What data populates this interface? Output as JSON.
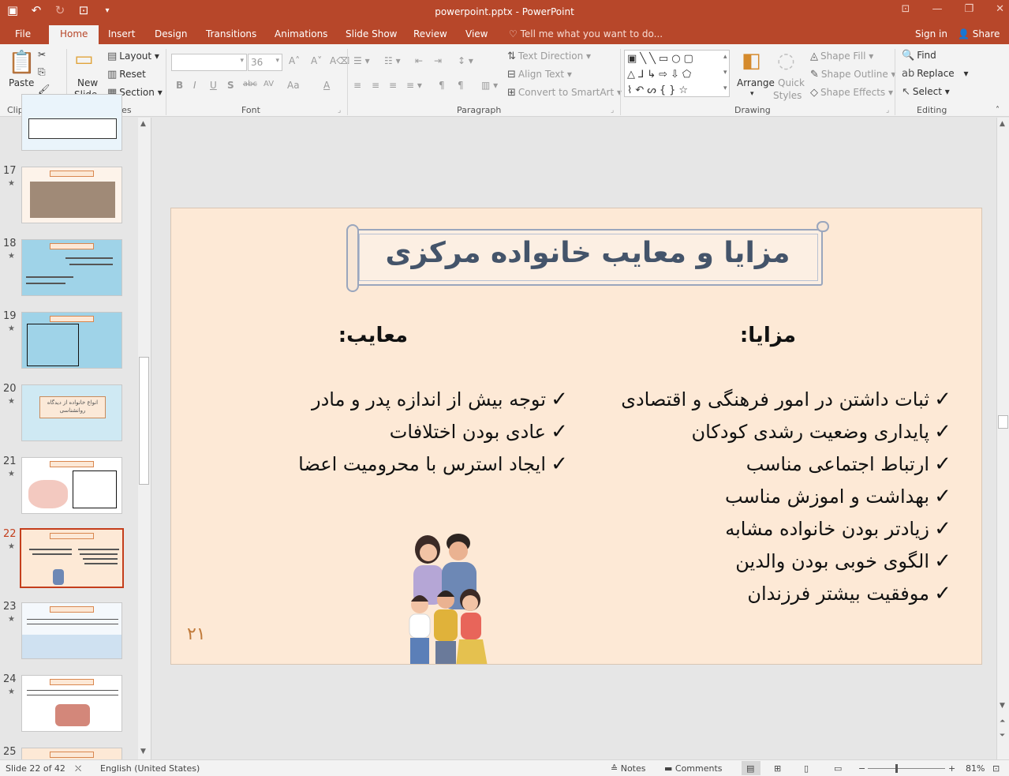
{
  "app": {
    "title": "powerpoint.pptx - PowerPoint"
  },
  "qat": {
    "save_icon": "save-icon",
    "undo_icon": "undo-icon",
    "redo_icon": "redo-icon",
    "present_icon": "present-from-start-icon",
    "customize_icon": "customize-qat-icon"
  },
  "tabs": [
    {
      "label": "File"
    },
    {
      "label": "Home"
    },
    {
      "label": "Insert"
    },
    {
      "label": "Design"
    },
    {
      "label": "Transitions"
    },
    {
      "label": "Animations"
    },
    {
      "label": "Slide Show"
    },
    {
      "label": "Review"
    },
    {
      "label": "View"
    }
  ],
  "tell_me": "Tell me what you want to do...",
  "sign_in": "Sign in",
  "share": "Share",
  "ribbon": {
    "clipboard": {
      "paste": "Paste",
      "label": "Clipboard"
    },
    "slides": {
      "new_slide": "New",
      "new_slide2": "Slide",
      "layout": "Layout",
      "reset": "Reset",
      "section": "Section",
      "label": "Slides"
    },
    "font": {
      "font_name": "",
      "font_size": "36",
      "label": "Font",
      "bold": "B",
      "italic": "I",
      "underline": "U",
      "shadow": "S",
      "strike": "abc",
      "spacing": "AV",
      "case": "Aa",
      "color": "A"
    },
    "paragraph": {
      "text_direction": "Text Direction",
      "align_text": "Align Text",
      "smartart": "Convert to SmartArt",
      "label": "Paragraph"
    },
    "drawing": {
      "arrange": "Arrange",
      "quick_styles": "Quick",
      "quick_styles2": "Styles",
      "shape_fill": "Shape Fill",
      "shape_outline": "Shape Outline",
      "shape_effects": "Shape Effects",
      "label": "Drawing"
    },
    "editing": {
      "find": "Find",
      "replace": "Replace",
      "select": "Select",
      "label": "Editing"
    }
  },
  "thumbnails": [
    {
      "num": "17"
    },
    {
      "num": "18"
    },
    {
      "num": "19"
    },
    {
      "num": "20",
      "title": "انواع خانواده از دیدگاه روانشناسی"
    },
    {
      "num": "21"
    },
    {
      "num": "22"
    },
    {
      "num": "23"
    },
    {
      "num": "24"
    },
    {
      "num": "25"
    }
  ],
  "slide": {
    "title": "مزایا و معایب خانواده مرکزی",
    "advantages_heading": "مزایا:",
    "disadvantages_heading": "معایب:",
    "advantages": [
      "ثبات داشتن در امور فرهنگی و اقتصادی",
      "پایداری وضعیت رشدی کودکان",
      "ارتباط اجتماعی مناسب",
      "بهداشت و اموزش مناسب",
      "زیادتر بودن خانواده مشابه",
      "الگوی خوبی بودن والدین",
      "موفقیت بیشتر فرزندان"
    ],
    "disadvantages": [
      "توجه بیش از اندازه پدر و مادر",
      "عادی بودن اختلافات",
      "ایجاد استرس با محرومیت اعضا"
    ],
    "check_glyph": "✓",
    "page_number": "۲۱"
  },
  "status": {
    "slide_info": "Slide 22 of 42",
    "language": "English (United States)",
    "notes": "Notes",
    "comments": "Comments",
    "zoom": "81%"
  },
  "colors": {
    "accent": "#b7472a",
    "slide_bg": "#fde9d6",
    "title_text": "#44546a"
  }
}
